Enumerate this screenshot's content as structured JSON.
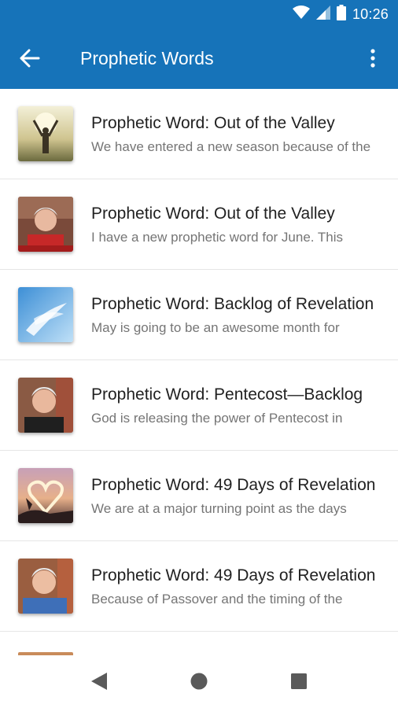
{
  "status_bar": {
    "time": "10:26"
  },
  "app_bar": {
    "title": "Prophetic Words"
  },
  "items": [
    {
      "title": "Prophetic Word: Out of the Valley",
      "subtitle": "We have entered a new season because of the"
    },
    {
      "title": "Prophetic Word: Out of the Valley",
      "subtitle": "I have a new prophetic word for June. This"
    },
    {
      "title": "Prophetic Word: Backlog of Revelation",
      "subtitle": "May is going to be an awesome month for"
    },
    {
      "title": "Prophetic Word: Pentecost—Backlog",
      "subtitle": "God is releasing the power of Pentecost in"
    },
    {
      "title": "Prophetic Word: 49 Days of Revelation",
      "subtitle": "We are at a major turning point as the days"
    },
    {
      "title": "Prophetic Word: 49 Days of Revelation",
      "subtitle": "Because of Passover and the timing of the"
    }
  ],
  "colors": {
    "primary": "#1673b9",
    "title_text": "#212121",
    "subtitle_text": "#757575"
  }
}
